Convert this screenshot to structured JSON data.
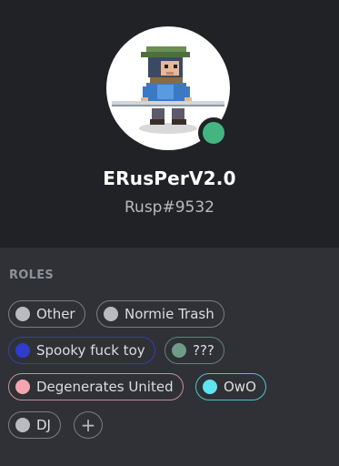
{
  "profile": {
    "username": "ERusPerV2.0",
    "tag": "Rusp#9532",
    "status": "online",
    "status_color": "#43b581"
  },
  "roles_section": {
    "header": "ROLES",
    "roles": [
      {
        "label": "Other",
        "color": "#b9bbbe"
      },
      {
        "label": "Normie Trash",
        "color": "#b9bbbe"
      },
      {
        "label": "Spooky fuck toy",
        "color": "#2f3ccf"
      },
      {
        "label": "???",
        "color": "#6f9c87"
      },
      {
        "label": "Degenerates United",
        "color": "#f4a6b0"
      },
      {
        "label": "OwO",
        "color": "#5de6ef"
      },
      {
        "label": "DJ",
        "color": "#b9bbbe"
      }
    ],
    "add_role_label": "+"
  }
}
